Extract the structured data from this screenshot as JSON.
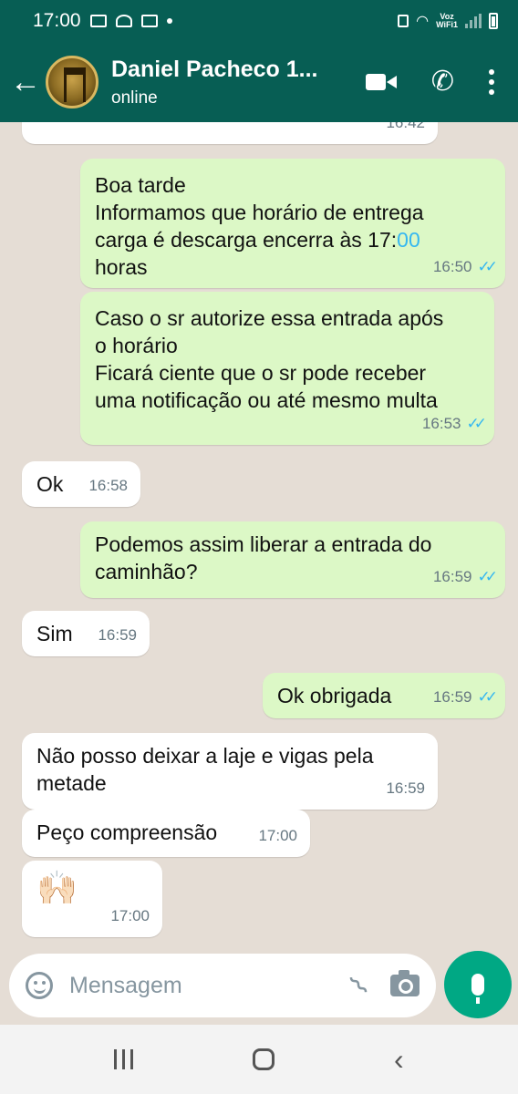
{
  "status_bar": {
    "time": "17:00",
    "network_label": "Voz\nWiFi1"
  },
  "header": {
    "contact_name": "Daniel Pacheco 1...",
    "status": "online"
  },
  "messages": [
    {
      "direction": "in",
      "text": "",
      "time": "16:42"
    },
    {
      "direction": "out",
      "text": "Boa tarde\nInformamos que horário de entrega\ncarga é descarga encerra às 17:",
      "highlight": "00",
      "text_after": "\nhoras",
      "time": "16:50",
      "read": true
    },
    {
      "direction": "out",
      "text": "Caso o sr autorize essa entrada após\no horário\nFicará ciente que o sr pode receber\numa notificação ou até mesmo multa",
      "time": "16:53",
      "read": true
    },
    {
      "direction": "in",
      "text": "Ok",
      "time": "16:58"
    },
    {
      "direction": "out",
      "text": "Podemos assim liberar a entrada do\ncaminhão?",
      "time": "16:59",
      "read": true
    },
    {
      "direction": "in",
      "text": "Sim",
      "time": "16:59"
    },
    {
      "direction": "out",
      "text": "Ok obrigada",
      "time": "16:59",
      "read": true
    },
    {
      "direction": "in",
      "text": "Não posso deixar a laje e vigas pela\nmetade",
      "time": "16:59"
    },
    {
      "direction": "in",
      "text": "Peço compreensão",
      "time": "17:00"
    },
    {
      "direction": "in",
      "text": "🙌🏻",
      "time": "17:00"
    }
  ],
  "input": {
    "placeholder": "Mensagem"
  },
  "icons": {
    "back": "arrow-left-icon",
    "video": "video-call-icon",
    "phone": "phone-icon",
    "menu": "more-vert-icon",
    "emoji": "emoji-icon",
    "attach": "paperclip-icon",
    "camera": "camera-icon",
    "mic": "microphone-icon"
  },
  "colors": {
    "header": "#075e54",
    "outgoing_bubble": "#dcf8c6",
    "incoming_bubble": "#ffffff",
    "read_ticks": "#34b7f1",
    "mic_button": "#00a884"
  }
}
